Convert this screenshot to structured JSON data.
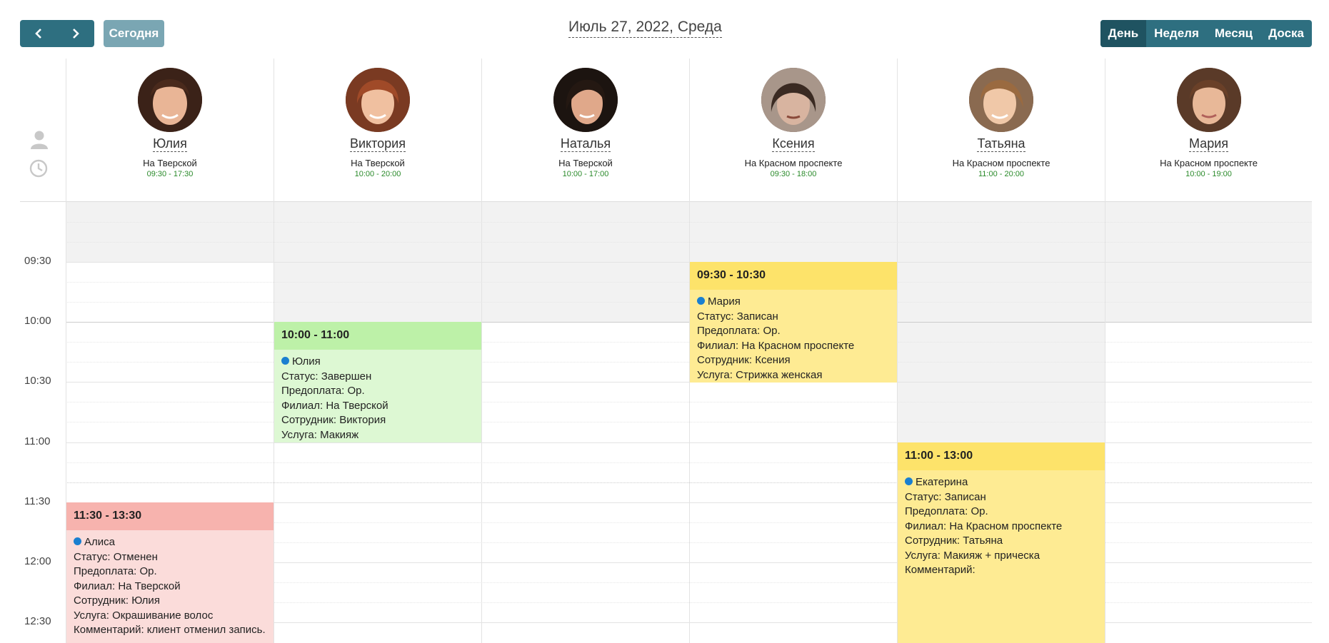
{
  "toolbar": {
    "prev_icon": "chevron-left-icon",
    "next_icon": "chevron-right-icon",
    "today_label": "Сегодня",
    "date_title": "Июль 27, 2022, Среда",
    "views": [
      "День",
      "Неделя",
      "Месяц",
      "Доска"
    ],
    "active_view": "День"
  },
  "gutter": {
    "person_icon": "person-icon",
    "clock_icon": "clock-icon"
  },
  "employees": [
    {
      "name": "Юлия",
      "branch": "На Тверской",
      "hours": "09:30 - 17:30"
    },
    {
      "name": "Виктория",
      "branch": "На Тверской",
      "hours": "10:00 - 20:00"
    },
    {
      "name": "Наталья",
      "branch": "На Тверской",
      "hours": "10:00 - 17:00"
    },
    {
      "name": "Ксения",
      "branch": "На Красном проспекте",
      "hours": "09:30 - 18:00"
    },
    {
      "name": "Татьяна",
      "branch": "На Красном проспекте",
      "hours": "11:00 - 20:00"
    },
    {
      "name": "Мария",
      "branch": "На Красном проспекте",
      "hours": "10:00 - 19:00"
    }
  ],
  "time_labels": [
    "09:30",
    "10:00",
    "10:30",
    "11:00",
    "11:30",
    "12:00",
    "12:30"
  ],
  "events": [
    {
      "time": "10:00 - 11:00",
      "client": "Юлия",
      "status": "Статус: Завершен",
      "prepay": "Предоплата: Ор.",
      "branch": "Филиал: На Тверской",
      "employee": "Сотрудник: Виктория",
      "service": "Услуга: Макияж",
      "color": "#bdf1a8"
    },
    {
      "time": "09:30 - 10:30",
      "client": "Мария",
      "status": "Статус: Записан",
      "prepay": "Предоплата: Ор.",
      "branch": "Филиал: На Красном проспекте",
      "employee": "Сотрудник: Ксения",
      "service": "Услуга: Стрижка женская",
      "color": "#fde36a"
    },
    {
      "time": "11:00 - 13:00",
      "client": "Екатерина",
      "status": "Статус: Записан",
      "prepay": "Предоплата: Ор.",
      "branch": "Филиал: На Красном проспекте",
      "employee": "Сотрудник: Татьяна",
      "service": "Услуга: Макияж + прическа",
      "comment": "Комментарий:",
      "color": "#fde36a"
    },
    {
      "time": "11:30 - 13:30",
      "client": "Алиса",
      "status": "Статус: Отменен",
      "prepay": "Предоплата: Ор.",
      "branch": "Филиал: На Тверской",
      "employee": "Сотрудник: Юлия",
      "service": "Услуга: Окрашивание волос",
      "comment": "Комментарий: клиент отменил запись.",
      "color": "#f7b3ae"
    }
  ]
}
